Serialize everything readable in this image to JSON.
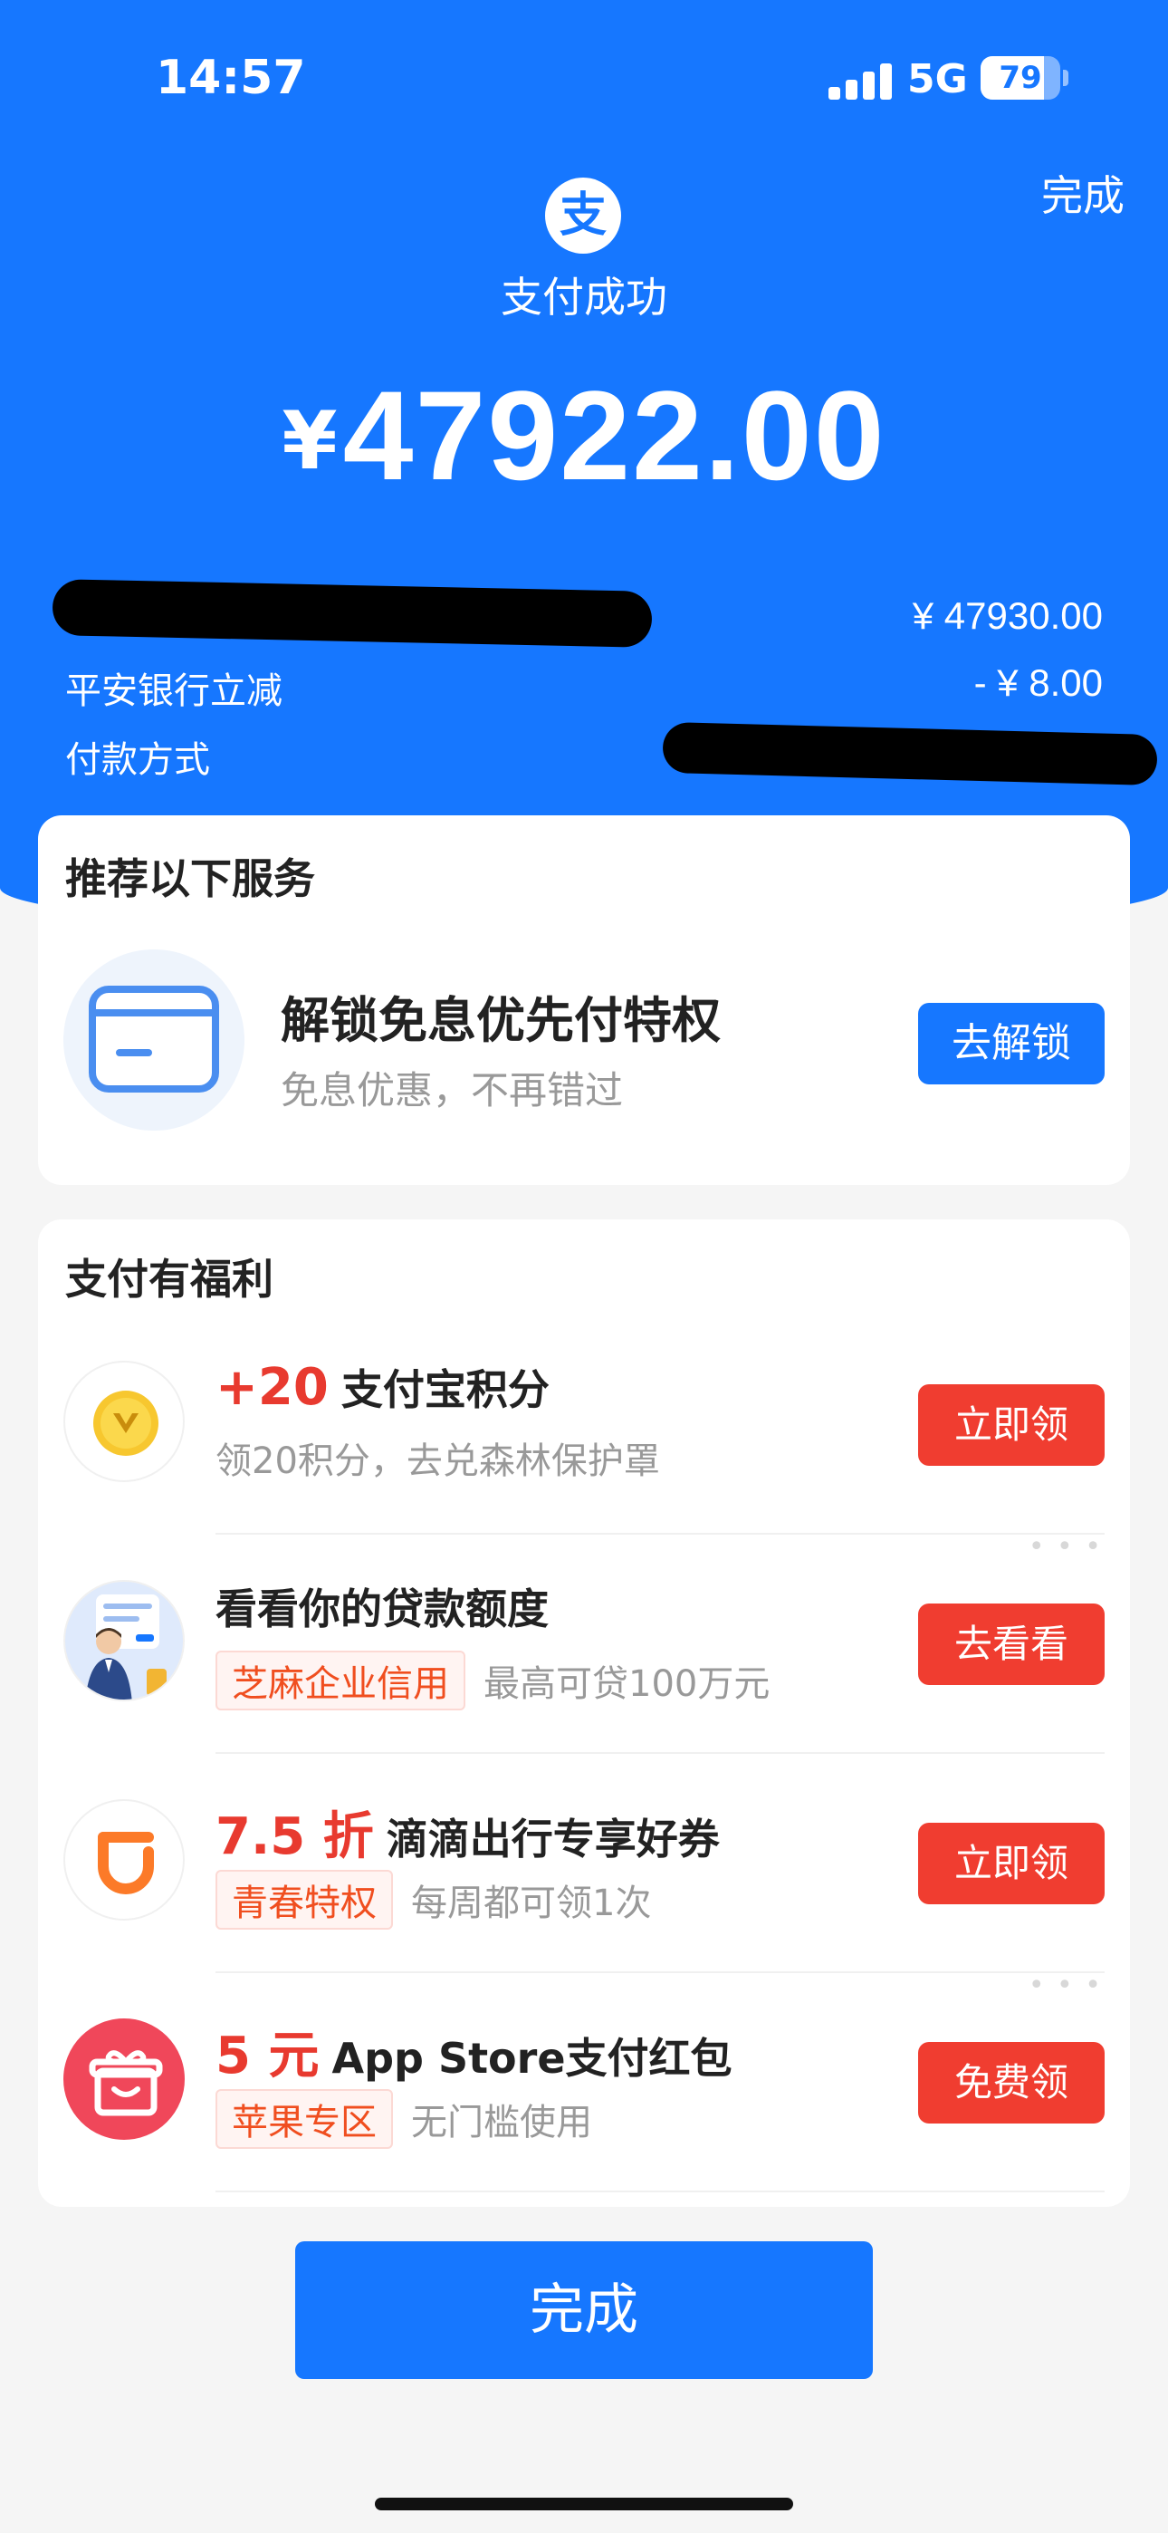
{
  "status_bar": {
    "time": "14:57",
    "network": "5G",
    "battery": "79",
    "battery_level_percent": 79
  },
  "header": {
    "done_label": "完成",
    "logo_char": "支",
    "status_text": "支付成功",
    "currency_symbol": "¥",
    "amount": "47922.00"
  },
  "details": {
    "merchant_amount": "¥ 47930.00",
    "discount_label": "平安银行立减",
    "discount_value": "- ¥ 8.00",
    "payment_method_label": "付款方式"
  },
  "recommend": {
    "title": "推荐以下服务",
    "service_title": "解锁免息优先付特权",
    "service_sub": "免息优惠，不再错过",
    "button": "去解锁"
  },
  "benefits": {
    "title": "支付有福利",
    "items": [
      {
        "highlight": "+20",
        "title": "支付宝积分",
        "tag": "",
        "sub": "领20积分，去兑森林保护罩",
        "button": "立即领",
        "icon": "gold-medal-icon"
      },
      {
        "highlight": "",
        "title": "看看你的贷款额度",
        "tag": "芝麻企业信用",
        "sub": "最高可贷100万元",
        "button": "去看看",
        "icon": "loan-avatar-icon"
      },
      {
        "highlight": "7.5 折",
        "title": "滴滴出行专享好券",
        "tag": "青春特权",
        "sub": "每周都可领1次",
        "button": "立即领",
        "icon": "didi-logo-icon"
      },
      {
        "highlight": "5 元",
        "title": "App Store支付红包",
        "tag": "苹果专区",
        "sub": "无门槛使用",
        "button": "免费领",
        "icon": "gift-icon"
      }
    ]
  },
  "footer": {
    "done_button": "完成"
  },
  "colors": {
    "brand_blue": "#1677ff",
    "action_red": "#f03d30",
    "highlight_red": "#e83a2f"
  }
}
